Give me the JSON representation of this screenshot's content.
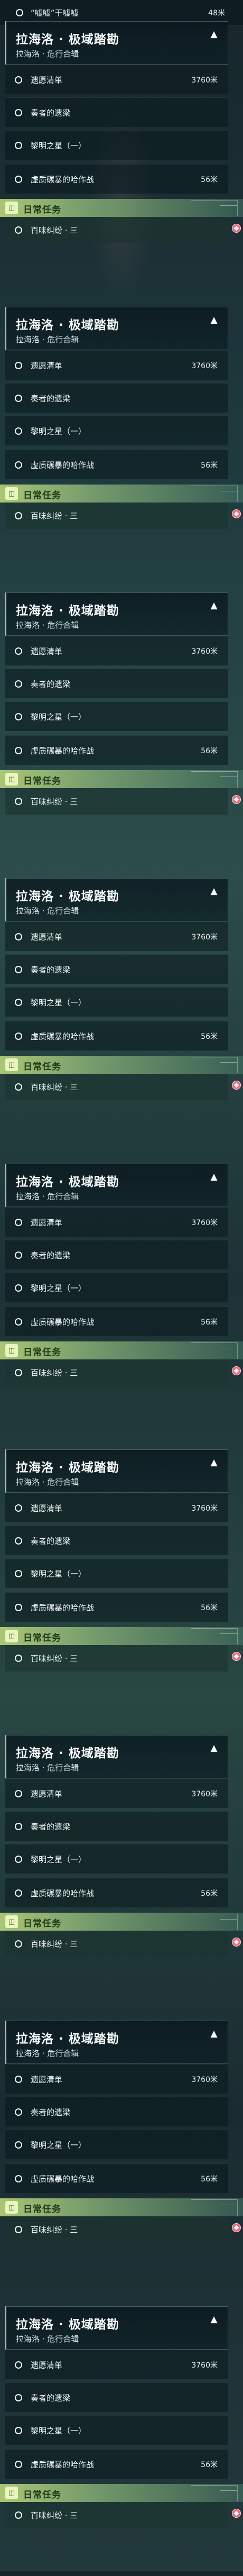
{
  "top_quest": {
    "label": "“嘘嘘”干嘘嘘",
    "distance": "48米"
  },
  "header": {
    "title": "拉海洛 · 极域踏勘",
    "subtitle": "拉海洛 · 危行合辑",
    "toggle_icon": "chevron-up-icon"
  },
  "quests": [
    {
      "label": "遗愿清单",
      "distance": "3760米"
    },
    {
      "label": "奏者的遗梁",
      "distance": ""
    },
    {
      "label": "黎明之星（一）",
      "distance": ""
    },
    {
      "label": "虚质碾暴的哈作战",
      "distance": "56米"
    }
  ],
  "daily": {
    "title": "日常任务",
    "item": "百味纠纷 · 三"
  },
  "colors": {
    "accent_green": "#b1cd78",
    "alert_red": "#ff5c73"
  }
}
